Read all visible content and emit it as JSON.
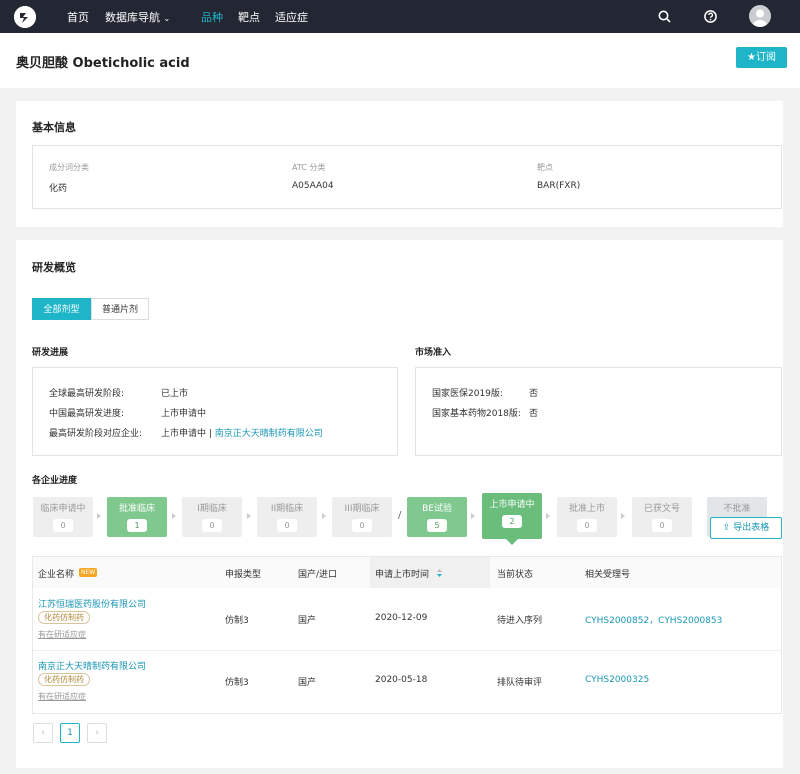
{
  "nav": {
    "home": "首页",
    "database_nav": "数据库导航",
    "variety": "品种",
    "target": "靶点",
    "indication": "适应症"
  },
  "header": {
    "title": "奥贝胆酸 Obeticholic acid",
    "subscribe": "★订阅"
  },
  "basic_info": {
    "heading": "基本信息",
    "fields": [
      {
        "label": "成分词分类",
        "value": "化药"
      },
      {
        "label": "ATC 分类",
        "value": "A05AA04"
      },
      {
        "label": "靶点",
        "value": "BAR(FXR)"
      }
    ]
  },
  "rd_overview": {
    "heading": "研发概览",
    "tabs": [
      "全部剂型",
      "普通片剂"
    ],
    "progress": {
      "heading": "研发进展",
      "rows": [
        {
          "label": "全球最高研发阶段:",
          "value": "已上市"
        },
        {
          "label": "中国最高研发进度:",
          "value": "上市申请中"
        },
        {
          "label": "最高研发阶段对应企业:",
          "value": "上市申请中 | ",
          "link": "南京正大天晴制药有限公司"
        }
      ]
    },
    "market": {
      "heading": "市场准入",
      "rows": [
        {
          "label": "国家医保2019版:",
          "value": "否"
        },
        {
          "label": "国家基本药物2018版:",
          "value": "否"
        }
      ]
    }
  },
  "company_progress": {
    "heading": "各企业进度",
    "stages": [
      {
        "label": "临床申请中",
        "count": "0"
      },
      {
        "label": "批准临床",
        "count": "1"
      },
      {
        "label": "I期临床",
        "count": "0"
      },
      {
        "label": "II期临床",
        "count": "0"
      },
      {
        "label": "III期临床",
        "count": "0"
      },
      {
        "label": "BE试验",
        "count": "5"
      },
      {
        "label": "上市申请中",
        "count": "2"
      },
      {
        "label": "批准上市",
        "count": "0"
      },
      {
        "label": "已获文号",
        "count": "0"
      },
      {
        "label": "不批准",
        "count": ""
      }
    ],
    "separator": "/",
    "export": "导出表格"
  },
  "table": {
    "headers": [
      "企业名称",
      "申报类型",
      "国产/进口",
      "申请上市时间",
      "当前状态",
      "相关受理号"
    ],
    "new_badge": "NEW",
    "rows": [
      {
        "company": "江苏恒瑞医药股份有限公司",
        "tag": "化药仿制药",
        "note": "有在研适应症",
        "type": "仿制3",
        "origin": "国产",
        "date": "2020-12-09",
        "status": "待进入序列",
        "numbers": "CYHS2000852，CYHS2000853"
      },
      {
        "company": "南京正大天晴制药有限公司",
        "tag": "化药仿制药",
        "note": "有在研适应症",
        "type": "仿制3",
        "origin": "国产",
        "date": "2020-05-18",
        "status": "排队待审评",
        "numbers": "CYHS2000325"
      }
    ]
  },
  "pagination": {
    "prev": "‹",
    "current": "1",
    "next": "›"
  },
  "colors": {
    "accent": "#1fb5c9",
    "nav_bg": "#232733",
    "stage_highlight": "#7fc98f"
  }
}
